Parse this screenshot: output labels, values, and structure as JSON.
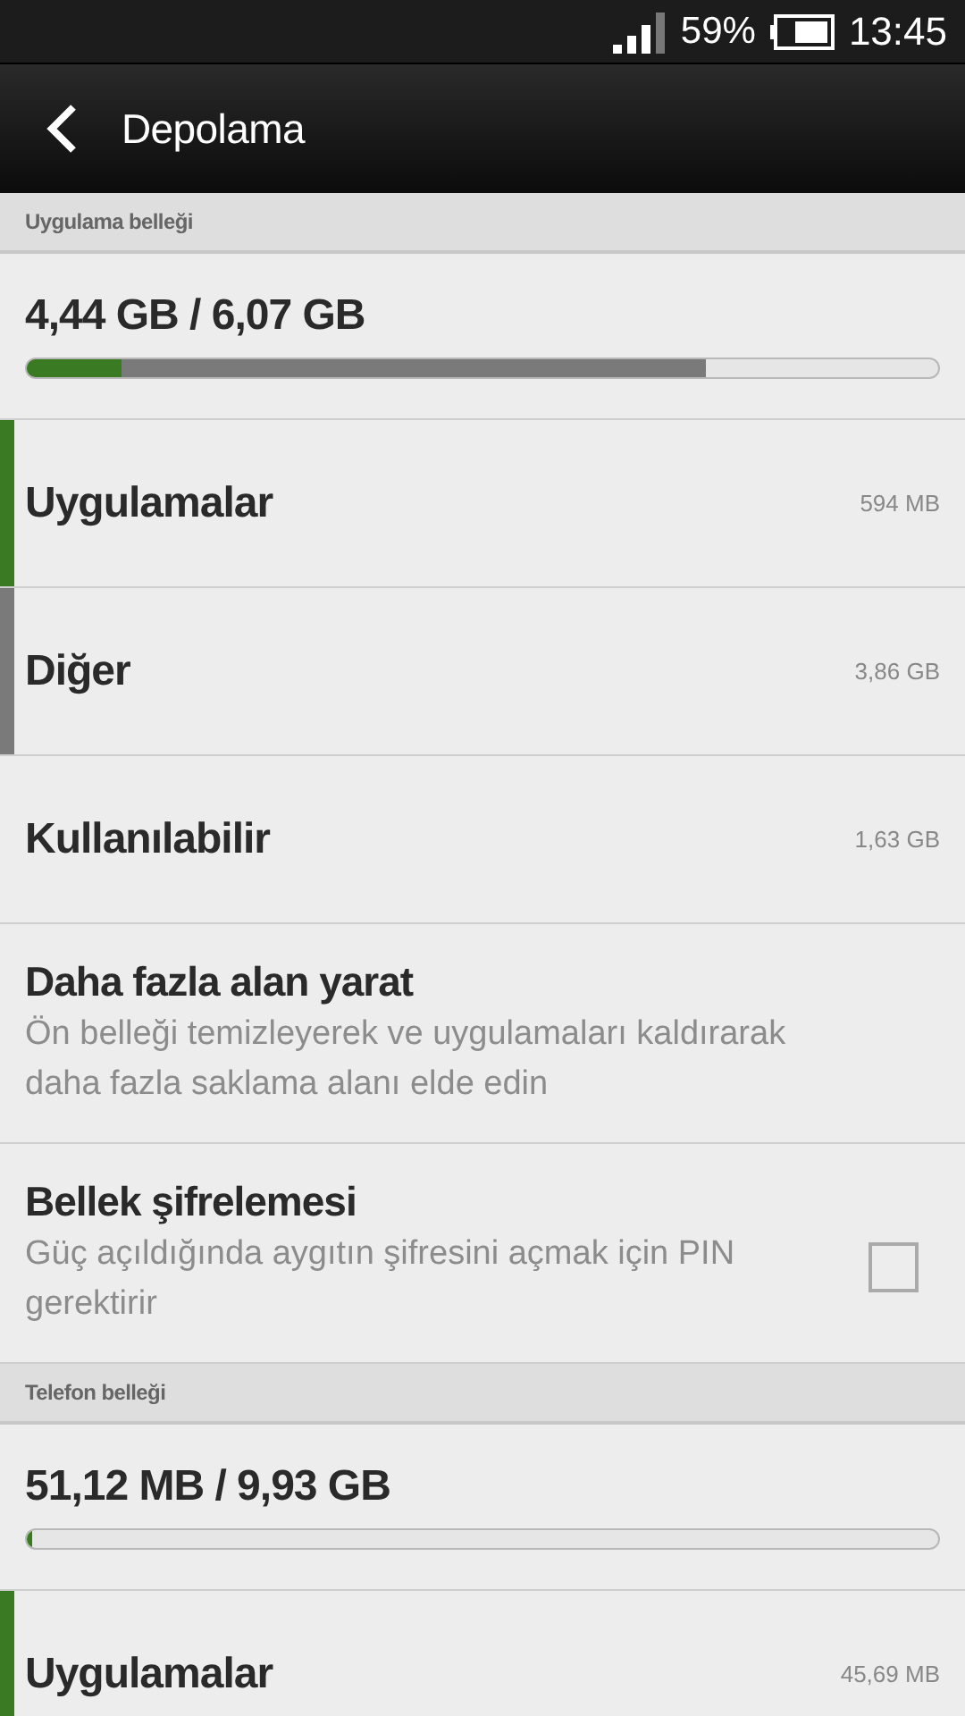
{
  "status_bar": {
    "battery_text": "59%",
    "time": "13:45"
  },
  "header": {
    "title": "Depolama"
  },
  "items": [
    {
      "kind": "section",
      "label": "Uygulama belleği"
    },
    {
      "kind": "usage",
      "text": "4,44 GB / 6,07 GB",
      "segments": [
        {
          "level": 0.104,
          "color": "#3a7a22"
        },
        {
          "level": 0.745,
          "color": "#7a7a7a"
        }
      ]
    },
    {
      "kind": "category",
      "label": "Uygulamalar",
      "value": "594 MB",
      "color": "#3a7a22"
    },
    {
      "kind": "category",
      "label": "Diğer",
      "value": "3,86 GB",
      "color": "#7a7a7a"
    },
    {
      "kind": "category",
      "label": "Kullanılabilir",
      "value": "1,63 GB"
    },
    {
      "kind": "action",
      "title": "Daha fazla alan yarat",
      "subtitle": "Ön belleği temizleyerek ve uygulamaları kaldırarak daha fazla saklama alanı elde edin"
    },
    {
      "kind": "checkbox",
      "title": "Bellek şifrelemesi",
      "subtitle": "Güç açıldığında aygıtın şifresini açmak için PIN gerektirir",
      "checked": false
    },
    {
      "kind": "section",
      "label": "Telefon belleği"
    },
    {
      "kind": "usage",
      "text": "51,12 MB / 9,93 GB",
      "segments": [
        {
          "level": 0.006,
          "color": "#3a7a22"
        }
      ]
    },
    {
      "kind": "category",
      "label": "Uygulamalar",
      "value": "45,69 MB",
      "color": "#3a7a22"
    }
  ]
}
